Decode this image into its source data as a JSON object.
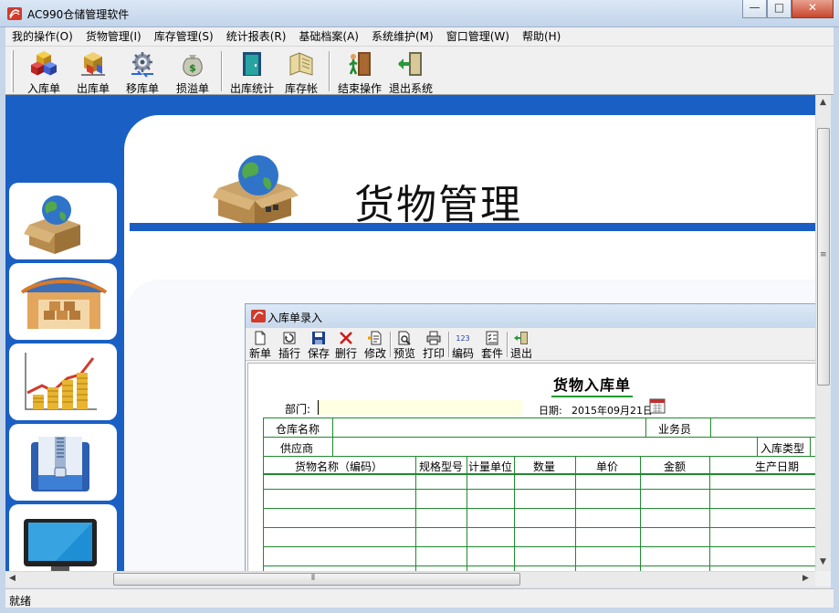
{
  "window": {
    "title": "AC990仓储管理软件",
    "controls": {
      "minimize": "—",
      "maximize": "□",
      "close": "✕"
    }
  },
  "menu": [
    "我的操作(O)",
    "货物管理(I)",
    "库存管理(S)",
    "统计报表(R)",
    "基础档案(A)",
    "系统维护(M)",
    "窗口管理(W)",
    "帮助(H)"
  ],
  "toolbar": {
    "inbound": "入库单",
    "outbound": "出库单",
    "transfer": "移库单",
    "loss_gain": "损溢单",
    "outbound_stats": "出库统计",
    "inventory_ledger": "库存帐",
    "end_operation": "结束操作",
    "exit_system": "退出系统"
  },
  "banner": {
    "title": "货物管理"
  },
  "child_window": {
    "title": "入库单录入",
    "toolbar": {
      "new": "新单",
      "insert_row": "插行",
      "save": "保存",
      "delete_row": "删行",
      "modify": "修改",
      "preview": "预览",
      "print": "打印",
      "encode": "编码",
      "encode_icon_text": "123",
      "kit": "套件",
      "exit": "退出"
    },
    "form": {
      "title": "货物入库单",
      "dept_label": "部门:",
      "dept_value": "",
      "date_label": "日期:",
      "date_value": "2015年09月21日",
      "warehouse_label": "仓库名称",
      "warehouse_value": "",
      "salesperson_label": "业务员",
      "salesperson_value": "",
      "supplier_label": "供应商",
      "supplier_value": "",
      "inbound_type_label": "入库类型",
      "columns": [
        "货物名称（编码）",
        "规格型号",
        "计量单位",
        "数量",
        "单价",
        "金额",
        "生产日期"
      ]
    }
  },
  "status": {
    "text": "就绪"
  },
  "colors": {
    "workspace_blue": "#1a60c4",
    "grid_green": "#1f8a2e",
    "dept_input_bg": "#ffffe1"
  }
}
